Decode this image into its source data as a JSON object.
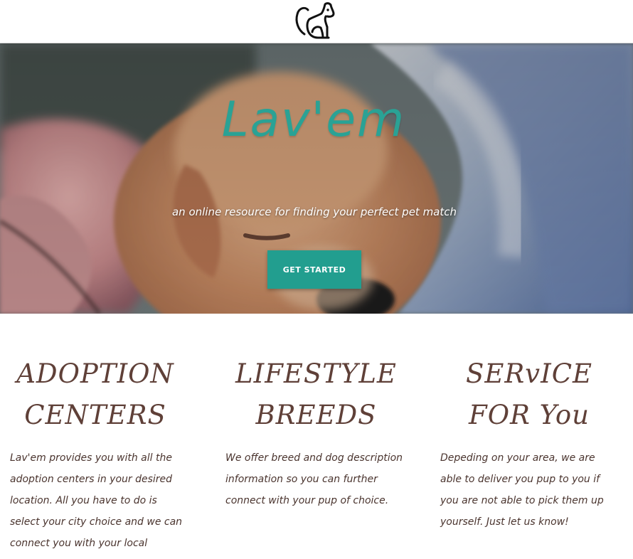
{
  "brand": {
    "icon": "dog-icon"
  },
  "hero": {
    "title": "Lav'em",
    "subtitle": "an online resource for finding your perfect pet match",
    "cta_label": "GET STARTED",
    "colors": {
      "title": "#2aa295",
      "button": "#229e8f"
    }
  },
  "features": [
    {
      "title": "ADOPTION CENTERS",
      "text": "Lav'em provides you with all the adoption centers in your desired location. All you have to do is select your city choice and we can connect you with your local"
    },
    {
      "title": "LIFESTYLE BREEDS",
      "text": "We offer breed and dog description information so you can further connect with your pup of choice."
    },
    {
      "title": "SERvICE FOR You",
      "text": "Depeding on your area, we are able to deliver you pup to you if you are not able to pick them up yourself. Just let us know!"
    }
  ],
  "colors": {
    "feature_title": "#5f4038",
    "feature_text": "#4a342e"
  }
}
